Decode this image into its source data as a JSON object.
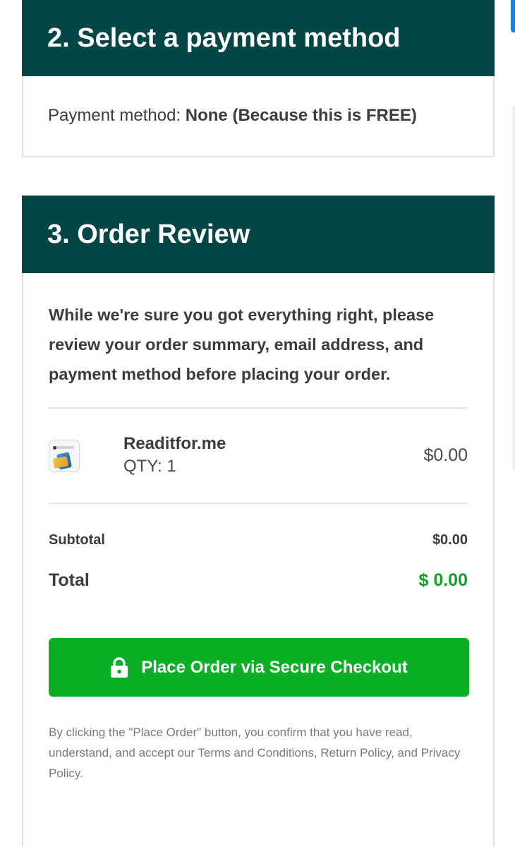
{
  "payment_section": {
    "title": "2. Select a payment method",
    "method_label": "Payment method:",
    "method_value": "None (Because this is FREE)"
  },
  "review_section": {
    "title": "3. Order Review",
    "intro": "While we're sure you got everything right, please review your order summary, email address, and payment method before placing your order.",
    "items": [
      {
        "name": "Readitfor.me",
        "qty": "QTY: 1",
        "price": "$0.00",
        "thumbnail": "readitfor-me-product-image"
      }
    ],
    "subtotal_label": "Subtotal",
    "subtotal_value": "$0.00",
    "total_label": "Total",
    "total_value": "$ 0.00",
    "place_order_label": "Place Order via Secure Checkout",
    "place_order_icon": "lock-icon",
    "legal_text": "By clicking the \"Place Order\" button, you confirm that you have read, understand, and accept our Terms and Conditions, Return Policy, and Privacy Policy."
  },
  "colors": {
    "header_bg": "#034645",
    "button_green": "#0aaf26",
    "total_green": "#14a02b",
    "scroll_tab_blue": "#1e7fd6"
  }
}
